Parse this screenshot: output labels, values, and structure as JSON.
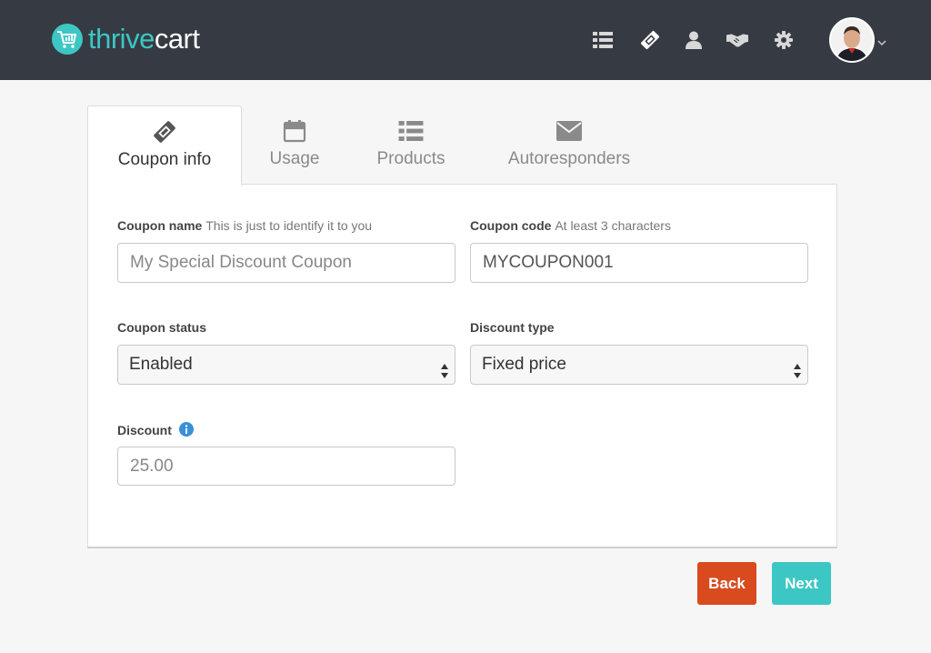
{
  "header": {
    "logo_part1": "thrive",
    "logo_part2": "cart",
    "nav_icons": [
      "list-icon",
      "ticket-icon",
      "user-icon",
      "handshake-icon",
      "gear-icon"
    ]
  },
  "tabs": [
    {
      "label": "Coupon info",
      "icon": "ticket-icon",
      "active": true
    },
    {
      "label": "Usage",
      "icon": "calendar-icon",
      "active": false
    },
    {
      "label": "Products",
      "icon": "list-icon",
      "active": false
    },
    {
      "label": "Autoresponders",
      "icon": "envelope-icon",
      "active": false
    }
  ],
  "form": {
    "coupon_name": {
      "label": "Coupon name",
      "hint": "This is just to identify it to you",
      "placeholder": "My Special Discount Coupon"
    },
    "coupon_code": {
      "label": "Coupon code",
      "hint": "At least 3 characters",
      "value": "MYCOUPON001"
    },
    "coupon_status": {
      "label": "Coupon status",
      "value": "Enabled"
    },
    "discount_type": {
      "label": "Discount type",
      "value": "Fixed price"
    },
    "discount": {
      "label": "Discount",
      "placeholder": "25.00"
    }
  },
  "buttons": {
    "back": "Back",
    "next": "Next"
  },
  "colors": {
    "header_bg": "#363b43",
    "accent": "#3cc7c4",
    "back_button": "#d94a1f"
  }
}
